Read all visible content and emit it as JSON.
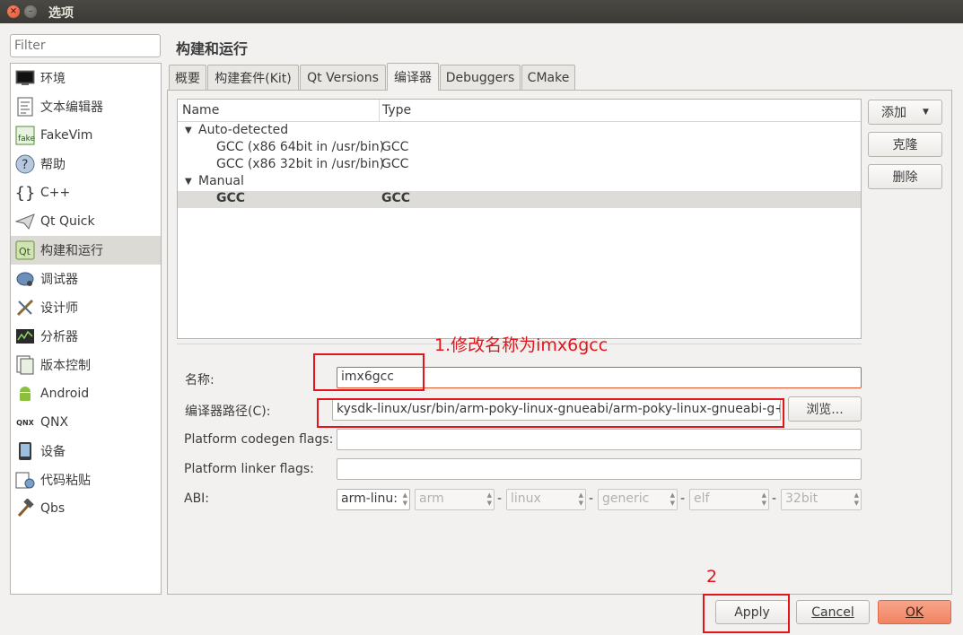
{
  "window": {
    "title": "选项"
  },
  "sidebar": {
    "filter_placeholder": "Filter",
    "items": [
      {
        "label": "环境",
        "icon": "monitor-icon"
      },
      {
        "label": "文本编辑器",
        "icon": "text-editor-icon"
      },
      {
        "label": "FakeVim",
        "icon": "fakevim-icon"
      },
      {
        "label": "帮助",
        "icon": "help-icon"
      },
      {
        "label": "C++",
        "icon": "braces-icon"
      },
      {
        "label": "Qt Quick",
        "icon": "paper-plane-icon"
      },
      {
        "label": "构建和运行",
        "icon": "build-run-icon",
        "selected": true
      },
      {
        "label": "调试器",
        "icon": "debugger-icon"
      },
      {
        "label": "设计师",
        "icon": "designer-icon"
      },
      {
        "label": "分析器",
        "icon": "analyzer-icon"
      },
      {
        "label": "版本控制",
        "icon": "version-control-icon"
      },
      {
        "label": "Android",
        "icon": "android-icon"
      },
      {
        "label": "QNX",
        "icon": "qnx-icon"
      },
      {
        "label": "设备",
        "icon": "device-icon"
      },
      {
        "label": "代码粘贴",
        "icon": "code-paste-icon"
      },
      {
        "label": "Qbs",
        "icon": "hammer-icon"
      }
    ]
  },
  "main": {
    "title": "构建和运行",
    "tabs": [
      "概要",
      "构建套件(Kit)",
      "Qt Versions",
      "编译器",
      "Debuggers",
      "CMake"
    ],
    "active_tab": 3,
    "tree": {
      "columns": [
        "Name",
        "Type"
      ],
      "groups": [
        {
          "label": "Auto-detected",
          "rows": [
            {
              "name": "GCC (x86 64bit in /usr/bin)",
              "type": "GCC"
            },
            {
              "name": "GCC (x86 32bit in /usr/bin)",
              "type": "GCC"
            }
          ]
        },
        {
          "label": "Manual",
          "rows": [
            {
              "name": "GCC",
              "type": "GCC",
              "selected": true
            }
          ]
        }
      ]
    },
    "side_buttons": {
      "add": "添加",
      "clone": "克隆",
      "remove": "删除"
    },
    "form": {
      "name_label": "名称:",
      "name_value": "imx6gcc",
      "path_label": "编译器路径(C):",
      "path_value": "kysdk-linux/usr/bin/arm-poky-linux-gnueabi/arm-poky-linux-gnueabi-g++",
      "browse": "浏览...",
      "codegen_label": "Platform codegen flags:",
      "codegen_value": "",
      "linker_label": "Platform linker flags:",
      "linker_value": "",
      "abi_label": "ABI:",
      "abi": [
        "arm-linu:",
        "arm",
        "linux",
        "generic",
        "elf",
        "32bit"
      ]
    },
    "annotations": {
      "step1": "1.修改名称为imx6gcc",
      "step2": "2"
    }
  },
  "footer": {
    "apply": "Apply",
    "cancel": "Cancel",
    "ok": "OK"
  },
  "colors": {
    "accent_annotation": "#e3141a",
    "ok_button": "#f18462",
    "focus_border": "#e4582f"
  }
}
